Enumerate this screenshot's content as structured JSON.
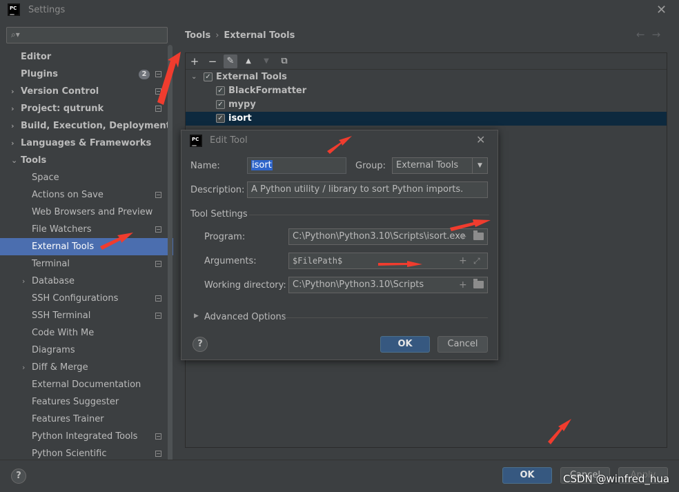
{
  "window": {
    "title": "Settings"
  },
  "search": {
    "placeholder": ""
  },
  "sidebar": {
    "items": [
      {
        "label": "Editor",
        "bold": true,
        "arrow": "",
        "level": 0
      },
      {
        "label": "Plugins",
        "bold": true,
        "arrow": "",
        "level": 0,
        "badge": "2"
      },
      {
        "label": "Version Control",
        "bold": true,
        "arrow": "›",
        "level": 0
      },
      {
        "label": "Project: qutrunk",
        "bold": true,
        "arrow": "›",
        "level": 0
      },
      {
        "label": "Build, Execution, Deployment",
        "bold": true,
        "arrow": "›",
        "level": 0
      },
      {
        "label": "Languages & Frameworks",
        "bold": true,
        "arrow": "›",
        "level": 0
      },
      {
        "label": "Tools",
        "bold": true,
        "arrow": "⌄",
        "level": 0
      },
      {
        "label": "Space",
        "level": 1
      },
      {
        "label": "Actions on Save",
        "level": 1
      },
      {
        "label": "Web Browsers and Preview",
        "level": 1
      },
      {
        "label": "File Watchers",
        "level": 1
      },
      {
        "label": "External Tools",
        "level": 1,
        "selected": true
      },
      {
        "label": "Terminal",
        "level": 1
      },
      {
        "label": "Database",
        "level": 1,
        "arrow": "›"
      },
      {
        "label": "SSH Configurations",
        "level": 1
      },
      {
        "label": "SSH Terminal",
        "level": 1
      },
      {
        "label": "Code With Me",
        "level": 1
      },
      {
        "label": "Diagrams",
        "level": 1
      },
      {
        "label": "Diff & Merge",
        "level": 1,
        "arrow": "›"
      },
      {
        "label": "External Documentation",
        "level": 1
      },
      {
        "label": "Features Suggester",
        "level": 1
      },
      {
        "label": "Features Trainer",
        "level": 1
      },
      {
        "label": "Python Integrated Tools",
        "level": 1
      },
      {
        "label": "Python Scientific",
        "level": 1
      }
    ]
  },
  "breadcrumb": {
    "parent": "Tools",
    "separator": "›",
    "current": "External Tools"
  },
  "toolbar": {
    "add": "+",
    "remove": "−",
    "edit": "✎",
    "up": "▲",
    "down": "▼",
    "copy": "⧉"
  },
  "tools_tree": [
    {
      "label": "External Tools",
      "group": true
    },
    {
      "label": "BlackFormatter"
    },
    {
      "label": "mypy"
    },
    {
      "label": "isort",
      "selected": true
    }
  ],
  "dialog": {
    "title": "Edit Tool",
    "name_label": "Name:",
    "name_value": "isort",
    "group_label": "Group:",
    "group_value": "External Tools",
    "description_label": "Description:",
    "description_value": "A Python utility / library to sort Python imports.",
    "tool_settings_title": "Tool Settings",
    "program_label": "Program:",
    "program_value": "C:\\Python\\Python3.10\\Scripts\\isort.exe",
    "arguments_label": "Arguments:",
    "arguments_value": "$FilePath$",
    "workdir_label": "Working directory:",
    "workdir_value": "C:\\Python\\Python3.10\\Scripts",
    "advanced_label": "Advanced Options",
    "ok_label": "OK",
    "cancel_label": "Cancel",
    "help_label": "?"
  },
  "footer": {
    "ok_label": "OK",
    "cancel_label": "Cancel",
    "apply_label": "Apply",
    "help_label": "?"
  },
  "watermark": "CSDN @winfred_hua",
  "annotation_color": "#f03c2e"
}
